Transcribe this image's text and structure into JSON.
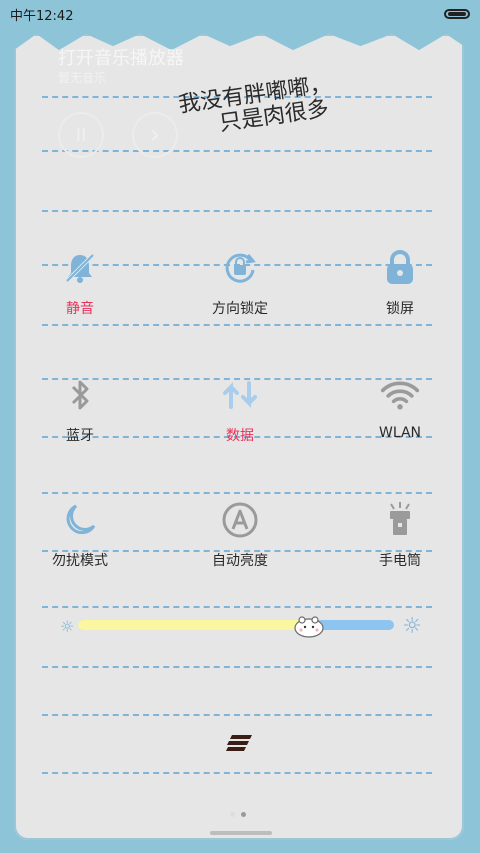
{
  "status_bar": {
    "time": "中午12:42"
  },
  "music": {
    "title": "打开音乐播放器",
    "subtitle": "暂无音乐",
    "pause_symbol": "II",
    "next_symbol": "›"
  },
  "handwriting": {
    "line1": "我没有胖嘟嘟，",
    "line2": "只是肉很多"
  },
  "tiles": {
    "mute": {
      "label": "静音",
      "icon": "bell-muted-icon"
    },
    "rotation_lock": {
      "label": "方向锁定",
      "icon": "rotation-lock-icon"
    },
    "lock_screen": {
      "label": "锁屏",
      "icon": "lock-icon"
    },
    "bluetooth": {
      "label": "蓝牙",
      "icon": "bluetooth-icon"
    },
    "mobile_data": {
      "label": "数据",
      "icon": "sync-arrows-icon"
    },
    "wlan": {
      "label": "WLAN",
      "icon": "wifi-icon"
    },
    "do_not_disturb": {
      "label": "勿扰模式",
      "icon": "moon-icon"
    },
    "auto_brightness": {
      "label": "自动亮度",
      "icon": "auto-brightness-icon"
    },
    "flashlight": {
      "label": "手电筒",
      "icon": "flashlight-icon"
    }
  },
  "brightness": {
    "value": 0.73,
    "min_icon": "sun-small-icon",
    "max_icon": "sun-large-icon"
  },
  "pager": {
    "pages": 2,
    "current": 2
  },
  "colors": {
    "accent_active": "#e8325c",
    "icon_blue": "#7fb4d8",
    "rule_blue": "#7fb4d8",
    "paper": "#e6e6e6",
    "background": "#8ec4d8",
    "slider_fill": "#fbf7a0",
    "slider_track": "#8ec4f0"
  }
}
